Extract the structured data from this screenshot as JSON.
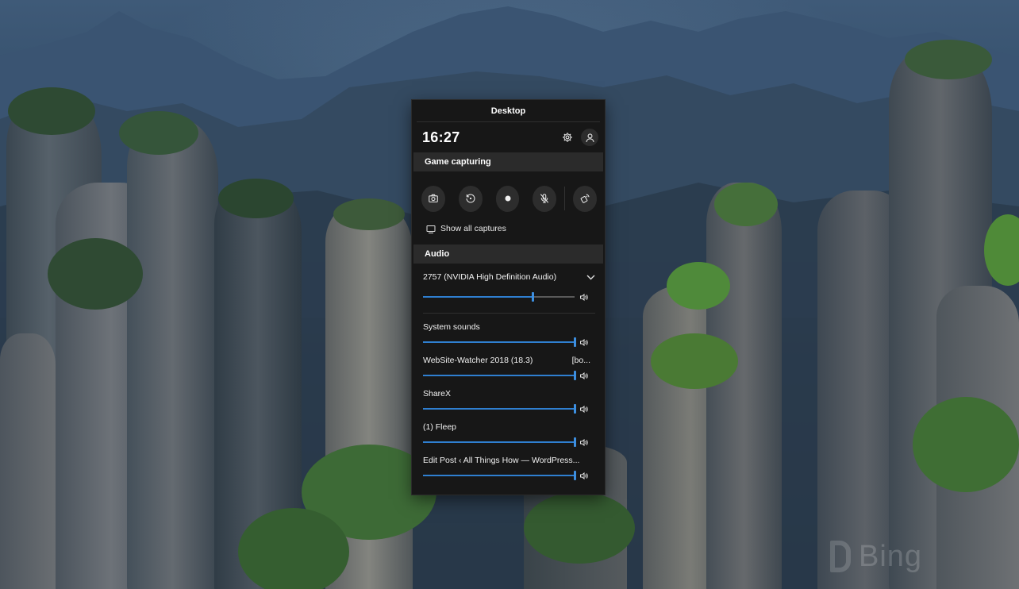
{
  "panel": {
    "title": "Desktop",
    "clock": "16:27",
    "settings_icon": "gear-icon",
    "profile_icon": "person-icon"
  },
  "capture": {
    "header": "Game capturing",
    "buttons": [
      {
        "icon": "screenshot-camera-icon"
      },
      {
        "icon": "record-last-30s-icon"
      },
      {
        "icon": "record-dot-icon"
      },
      {
        "icon": "microphone-off-icon"
      },
      {
        "icon": "broadcast-icon"
      }
    ],
    "show_all_label": "Show all captures"
  },
  "audio": {
    "header": "Audio",
    "device": {
      "name": "2757 (NVIDIA High Definition Audio)",
      "volume": 0.72
    },
    "apps": [
      {
        "name": "System sounds",
        "extra": "",
        "volume": 1.0
      },
      {
        "name": "WebSite-Watcher 2018 (18.3)",
        "extra": "[bo...",
        "volume": 1.0
      },
      {
        "name": "ShareX",
        "extra": "",
        "volume": 1.0
      },
      {
        "name": "(1) Fleep",
        "extra": "",
        "volume": 1.0
      },
      {
        "name": "Edit Post ‹ All Things How — WordPress...",
        "extra": "",
        "volume": 1.0
      }
    ]
  },
  "wallpaper": {
    "watermark": "Bing"
  },
  "colors": {
    "panel_bg": "#171717",
    "section_bg": "#2b2b2b",
    "accent": "#2f7fd0"
  }
}
